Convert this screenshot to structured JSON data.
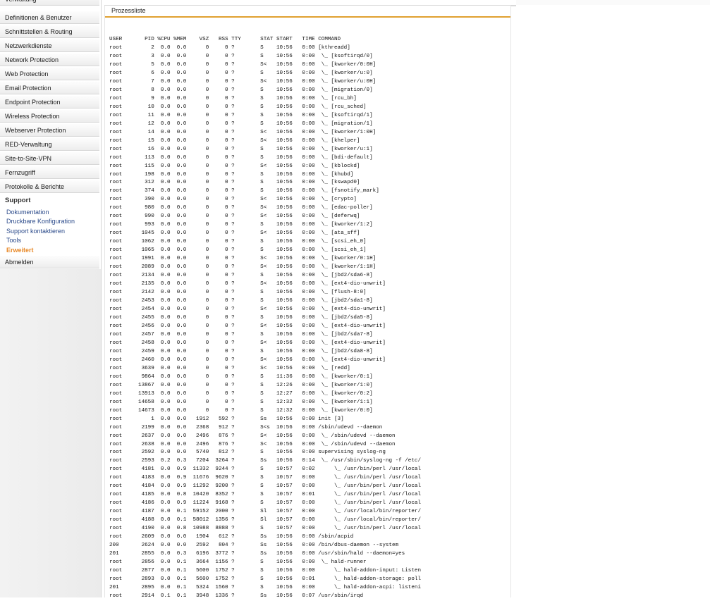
{
  "sidebar": {
    "items": [
      {
        "label": "Verwaltung"
      },
      {
        "label": "Definitionen & Benutzer"
      },
      {
        "label": "Schnittstellen & Routing"
      },
      {
        "label": "Netzwerkdienste"
      },
      {
        "label": "Network Protection"
      },
      {
        "label": "Web Protection"
      },
      {
        "label": "Email Protection"
      },
      {
        "label": "Endpoint Protection"
      },
      {
        "label": "Wireless Protection"
      },
      {
        "label": "Webserver Protection"
      },
      {
        "label": "RED-Verwaltung"
      },
      {
        "label": "Site-to-Site-VPN"
      },
      {
        "label": "Fernzugriff"
      },
      {
        "label": "Protokolle & Berichte"
      }
    ],
    "support": {
      "heading": "Support",
      "items": [
        {
          "label": "Dokumentation"
        },
        {
          "label": "Druckbare Konfiguration"
        },
        {
          "label": "Support kontaktieren"
        },
        {
          "label": "Tools"
        },
        {
          "label": "Erweitert"
        }
      ]
    },
    "logout": "Abmelden"
  },
  "panel": {
    "tab": "Prozessliste",
    "process_list": "USER       PID %CPU %MEM    VSZ   RSS TTY      STAT START   TIME COMMAND\nroot         2  0.0  0.0      0     0 ?        S    10:56   0:00 [kthreadd]\nroot         3  0.0  0.0      0     0 ?        S    10:56   0:00  \\_ [ksoftirqd/0]\nroot         5  0.0  0.0      0     0 ?        S<   10:56   0:00  \\_ [kworker/0:0H]\nroot         6  0.0  0.0      0     0 ?        S    10:56   0:00  \\_ [kworker/u:0]\nroot         7  0.0  0.0      0     0 ?        S<   10:56   0:00  \\_ [kworker/u:0H]\nroot         8  0.0  0.0      0     0 ?        S    10:56   0:00  \\_ [migration/0]\nroot         9  0.0  0.0      0     0 ?        S    10:56   0:00  \\_ [rcu_bh]\nroot        10  0.0  0.0      0     0 ?        S    10:56   0:00  \\_ [rcu_sched]\nroot        11  0.0  0.0      0     0 ?        S    10:56   0:00  \\_ [ksoftirqd/1]\nroot        12  0.0  0.0      0     0 ?        S    10:56   0:00  \\_ [migration/1]\nroot        14  0.0  0.0      0     0 ?        S<   10:56   0:00  \\_ [kworker/1:0H]\nroot        15  0.0  0.0      0     0 ?        S<   10:56   0:00  \\_ [khelper]\nroot        16  0.0  0.0      0     0 ?        S    10:56   0:00  \\_ [kworker/u:1]\nroot       113  0.0  0.0      0     0 ?        S    10:56   0:00  \\_ [bdi-default]\nroot       115  0.0  0.0      0     0 ?        S<   10:56   0:00  \\_ [kblockd]\nroot       198  0.0  0.0      0     0 ?        S    10:56   0:00  \\_ [khubd]\nroot       312  0.0  0.0      0     0 ?        S    10:56   0:00  \\_ [kswapd0]\nroot       374  0.0  0.0      0     0 ?        S    10:56   0:00  \\_ [fsnotify_mark]\nroot       390  0.0  0.0      0     0 ?        S<   10:56   0:00  \\_ [crypto]\nroot       980  0.0  0.0      0     0 ?        S<   10:56   0:00  \\_ [edac-poller]\nroot       990  0.0  0.0      0     0 ?        S<   10:56   0:00  \\_ [deferwq]\nroot       993  0.0  0.0      0     0 ?        S    10:56   0:00  \\_ [kworker/1:2]\nroot      1045  0.0  0.0      0     0 ?        S<   10:56   0:00  \\_ [ata_sff]\nroot      1062  0.0  0.0      0     0 ?        S    10:56   0:00  \\_ [scsi_eh_0]\nroot      1065  0.0  0.0      0     0 ?        S    10:56   0:00  \\_ [scsi_eh_1]\nroot      1991  0.0  0.0      0     0 ?        S<   10:56   0:00  \\_ [kworker/0:1H]\nroot      2089  0.0  0.0      0     0 ?        S<   10:56   0:00  \\_ [kworker/1:1H]\nroot      2134  0.0  0.0      0     0 ?        S    10:56   0:00  \\_ [jbd2/sda6-8]\nroot      2135  0.0  0.0      0     0 ?        S<   10:56   0:00  \\_ [ext4-dio-unwrit]\nroot      2142  0.0  0.0      0     0 ?        S    10:56   0:00  \\_ [flush-8:0]\nroot      2453  0.0  0.0      0     0 ?        S    10:56   0:00  \\_ [jbd2/sda1-8]\nroot      2454  0.0  0.0      0     0 ?        S<   10:56   0:00  \\_ [ext4-dio-unwrit]\nroot      2455  0.0  0.0      0     0 ?        S    10:56   0:00  \\_ [jbd2/sda5-8]\nroot      2456  0.0  0.0      0     0 ?        S<   10:56   0:00  \\_ [ext4-dio-unwrit]\nroot      2457  0.0  0.0      0     0 ?        S    10:56   0:00  \\_ [jbd2/sda7-8]\nroot      2458  0.0  0.0      0     0 ?        S<   10:56   0:00  \\_ [ext4-dio-unwrit]\nroot      2459  0.0  0.0      0     0 ?        S    10:56   0:00  \\_ [jbd2/sda8-8]\nroot      2460  0.0  0.0      0     0 ?        S<   10:56   0:00  \\_ [ext4-dio-unwrit]\nroot      3639  0.0  0.0      0     0 ?        S<   10:56   0:00  \\_ [redd]\nroot      9864  0.0  0.0      0     0 ?        S    11:36   0:00  \\_ [kworker/0:1]\nroot     13867  0.0  0.0      0     0 ?        S    12:26   0:00  \\_ [kworker/1:0]\nroot     13913  0.0  0.0      0     0 ?        S    12:27   0:00  \\_ [kworker/0:2]\nroot     14658  0.0  0.0      0     0 ?        S    12:32   0:00  \\_ [kworker/1:1]\nroot     14673  0.0  0.0      0     0 ?        S    12:32   0:00  \\_ [kworker/0:0]\nroot         1  0.0  0.0   1912   592 ?        Ss   10:56   0:00 init [3]\nroot      2199  0.0  0.0   2368   912 ?        S<s  10:56   0:00 /sbin/udevd --daemon\nroot      2637  0.0  0.0   2496   876 ?        S<   10:56   0:00  \\_ /sbin/udevd --daemon\nroot      2638  0.0  0.0   2496   876 ?        S<   10:56   0:00  \\_ /sbin/udevd --daemon\nroot      2592  0.0  0.0   5740   812 ?        S    10:56   0:00 supervising syslog-ng\nroot      2593  0.2  0.3   7204  3264 ?        Ss   10:56   0:14  \\_ /usr/sbin/syslog-ng -f /etc/\nroot      4181  0.0  0.9  11332  9244 ?        S    10:57   0:02      \\_ /usr/bin/perl /usr/local\nroot      4183  0.0  0.9  11676  9620 ?        S    10:57   0:00      \\_ /usr/bin/perl /usr/local\nroot      4184  0.0  0.9  11292  9200 ?        S    10:57   0:00      \\_ /usr/bin/perl /usr/local\nroot      4185  0.0  0.8  10420  8352 ?        S    10:57   0:01      \\_ /usr/bin/perl /usr/local\nroot      4186  0.0  0.9  11224  9168 ?        S    10:57   0:00      \\_ /usr/bin/perl /usr/local\nroot      4187  0.0  0.1  59152  2000 ?        Sl   10:57   0:00      \\_ /usr/local/bin/reporter/\nroot      4188  0.0  0.1  58012  1356 ?        Sl   10:57   0:00      \\_ /usr/local/bin/reporter/\nroot      4190  0.0  0.8  10988  8888 ?        S    10:57   0:00      \\_ /usr/bin/perl /usr/local\nroot      2609  0.0  0.0   1904   612 ?        Ss   10:56   0:00 /sbin/acpid\n200       2624  0.0  0.0   2592   804 ?        Ss   10:56   0:00 /bin/dbus-daemon --system\n201       2855  0.0  0.3   6196  3772 ?        Ss   10:56   0:00 /usr/sbin/hald --daemon=yes\nroot      2856  0.0  0.1   3664  1156 ?        S    10:56   0:00  \\_ hald-runner\nroot      2877  0.0  0.1   5600  1752 ?        S    10:56   0:00      \\_ hald-addon-input: Listen\nroot      2893  0.0  0.1   5600  1752 ?        S    10:56   0:01      \\_ hald-addon-storage: poll\n201       2895  0.0  0.1   5324  1560 ?        S    10:56   0:00      \\_ hald-addon-acpi: listeni\nroot      2914  0.1  0.1   3948  1336 ?        Ss   10:56   0:07 /usr/sbin/irqd"
  }
}
